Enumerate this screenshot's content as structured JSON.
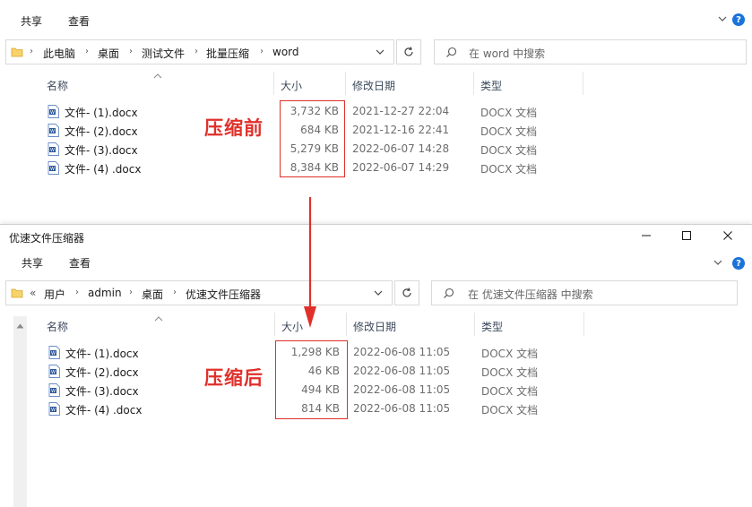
{
  "window1": {
    "ribbon": {
      "share": "共享",
      "view": "查看"
    },
    "breadcrumb": [
      "此电脑",
      "桌面",
      "测试文件",
      "批量压缩",
      "word"
    ],
    "search_placeholder": "在 word 中搜索",
    "columns": {
      "name": "名称",
      "size": "大小",
      "modified": "修改日期",
      "type": "类型"
    },
    "files": [
      {
        "name": "文件- (1).docx",
        "size": "3,732 KB",
        "date": "2021-12-27 22:04",
        "type": "DOCX 文档"
      },
      {
        "name": "文件- (2).docx",
        "size": "684 KB",
        "date": "2021-12-16 22:41",
        "type": "DOCX 文档"
      },
      {
        "name": "文件- (3).docx",
        "size": "5,279 KB",
        "date": "2022-06-07 14:28",
        "type": "DOCX 文档"
      },
      {
        "name": "文件- (4) .docx",
        "size": "8,384 KB",
        "date": "2022-06-07 14:29",
        "type": "DOCX 文档"
      }
    ],
    "annotation": "压缩前"
  },
  "window2": {
    "title": "优速文件压缩器",
    "ribbon": {
      "share": "共享",
      "view": "查看"
    },
    "breadcrumb_prefix": "«",
    "breadcrumb": [
      "用户",
      "admin",
      "桌面",
      "优速文件压缩器"
    ],
    "search_placeholder": "在 优速文件压缩器 中搜索",
    "columns": {
      "name": "名称",
      "size": "大小",
      "modified": "修改日期",
      "type": "类型"
    },
    "files": [
      {
        "name": "文件- (1).docx",
        "size": "1,298 KB",
        "date": "2022-06-08 11:05",
        "type": "DOCX 文档"
      },
      {
        "name": "文件- (2).docx",
        "size": "46 KB",
        "date": "2022-06-08 11:05",
        "type": "DOCX 文档"
      },
      {
        "name": "文件- (3).docx",
        "size": "494 KB",
        "date": "2022-06-08 11:05",
        "type": "DOCX 文档"
      },
      {
        "name": "文件- (4) .docx",
        "size": "814 KB",
        "date": "2022-06-08 11:05",
        "type": "DOCX 文档"
      }
    ],
    "annotation": "压缩后"
  },
  "colors": {
    "accent_red": "#e0302a",
    "word_blue": "#2b5797",
    "help_blue": "#1a73d9"
  }
}
